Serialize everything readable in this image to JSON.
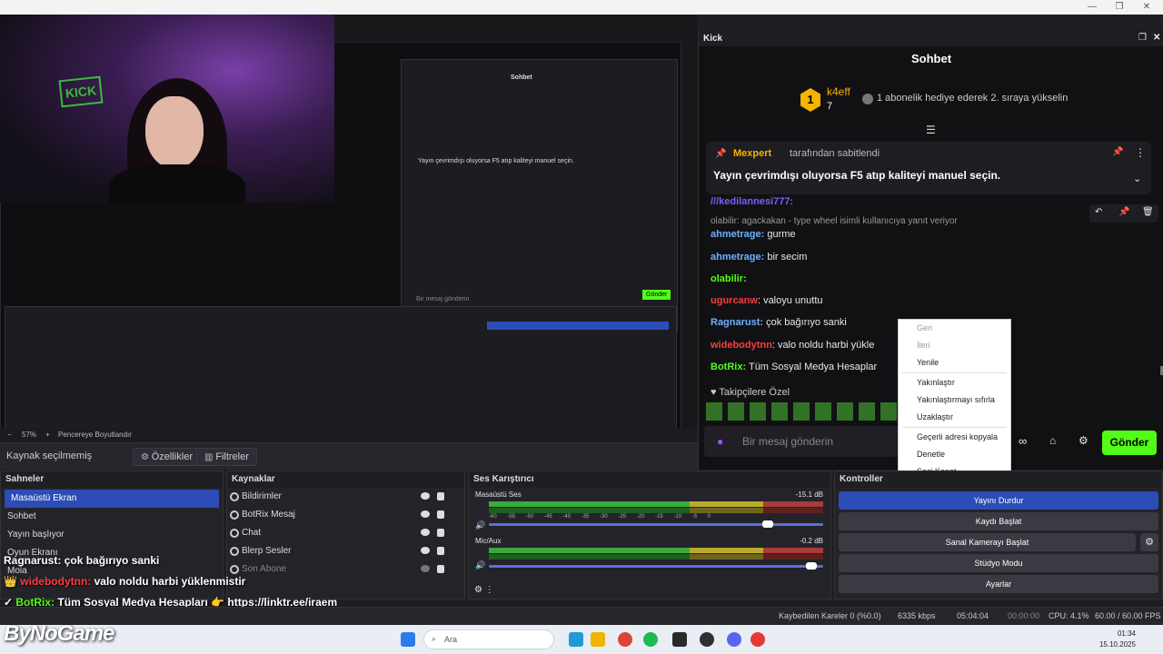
{
  "window": {
    "minimize": "—",
    "restore": "❐",
    "close": "✕"
  },
  "preview": {
    "zoom": "57%",
    "fit_label": "Pencereye Boyutlandır",
    "no_source": "Kaynak seçilmemiş",
    "properties_btn": "Özellikler",
    "filters_btn": "Filtreler"
  },
  "kick": {
    "app_name": "Kick",
    "title": "Sohbet",
    "goal": {
      "user": "k4eff",
      "count": "7",
      "rank": "1",
      "text": "1 abonelik hediye ederek 2. sıraya yükselin"
    },
    "pinned": {
      "by_user": "Mexpert",
      "by_suffix": "tarafından sabitlendi",
      "message": "Yayın çevrimdışı oluyorsa F5 atıp kaliteyi manuel seçin."
    },
    "messages": [
      {
        "user": "///kedilannesi777:",
        "text": "",
        "color": "#7c5cff"
      },
      {
        "reply": "olabilir: agackakan - type wheel isimli kullanıcıya yanıt veriyor"
      },
      {
        "user": "ahmetrage:",
        "text": "gurme",
        "color": "#6fb0ff"
      },
      {
        "user": "ahmetrage:",
        "text": "bir secim",
        "color": "#6fb0ff"
      },
      {
        "user": "olabilir:",
        "text": "",
        "color": "#53fc18"
      },
      {
        "user": "ugurcanw",
        "text": ": valoyu unuttu",
        "color": "#ff3b3b"
      },
      {
        "user": "Ragnarust:",
        "text": "çok bağırıyo sanki",
        "color": "#6fb0ff"
      },
      {
        "user": "widebodytnn",
        "text": ": valo noldu harbi yükle",
        "color": "#ff3b3b"
      },
      {
        "user": "BotRix:",
        "text": "Tüm Sosyal Medya Hesaplar",
        "color": "#53fc18"
      }
    ],
    "follower_label": "Takipçilere Özel",
    "input_placeholder": "Bir mesaj gönderin",
    "send": "Gönder"
  },
  "context_menu": {
    "items": [
      "Geri",
      "İleri",
      "Yenile",
      "Yakınlaştır",
      "Yakınlaştırmayı sıfırla",
      "Uzaklaştır",
      "Geçerli adresi kopyala",
      "Denetle",
      "Sesi Kapat"
    ]
  },
  "scenes": {
    "title": "Sahneler",
    "items": [
      "Masaüstü Ekran",
      "Sohbet",
      "Yayın başlıyor",
      "Oyun Ekranı",
      "Mola"
    ]
  },
  "sources": {
    "title": "Kaynaklar",
    "items": [
      "Bildirimler",
      "BotRix Mesaj",
      "Chat",
      "Blerp Sesler",
      "Son Abone"
    ]
  },
  "mixer": {
    "title": "Ses Karıştırıcı",
    "channels": [
      {
        "name": "Masaüstü Ses",
        "db": "-15.1 dB",
        "level": 0.85
      },
      {
        "name": "Mic/Aux",
        "db": "-0.2 dB",
        "level": 0.98
      }
    ],
    "ticks": [
      "-60",
      "-55",
      "-50",
      "-45",
      "-40",
      "-35",
      "-30",
      "-25",
      "-20",
      "-15",
      "-10",
      "-5",
      "0"
    ]
  },
  "controls": {
    "title": "Kontroller",
    "buttons": [
      "Yayını Durdur",
      "Kaydı Başlat",
      "Sanal Kamerayı Başlat",
      "Stüdyo Modu",
      "Ayarlar"
    ]
  },
  "overlay": {
    "lines": [
      {
        "user": "Ragnarust:",
        "text": "çok bağırıyo sanki"
      },
      {
        "user": "widebodytnn:",
        "text": "valo noldu harbi yüklenmistir"
      },
      {
        "user": "BotRix:",
        "text": "Tüm Sosyal Medya Hesapları 👉 https://linktr.ee/iraem"
      }
    ],
    "brand": "ByNoGame"
  },
  "status": {
    "dropped": "Kaybedilen Kareler 0 (%0.0)",
    "bitrate": "6335 kbps",
    "live_time": "05:04:04",
    "rec_time": "00:00:00",
    "cpu": "CPU: 4.1%",
    "fps": "60.00 / 60.00 FPS"
  },
  "taskbar": {
    "search_placeholder": "Ara",
    "time": "01:34",
    "date": "15.10.2025"
  }
}
